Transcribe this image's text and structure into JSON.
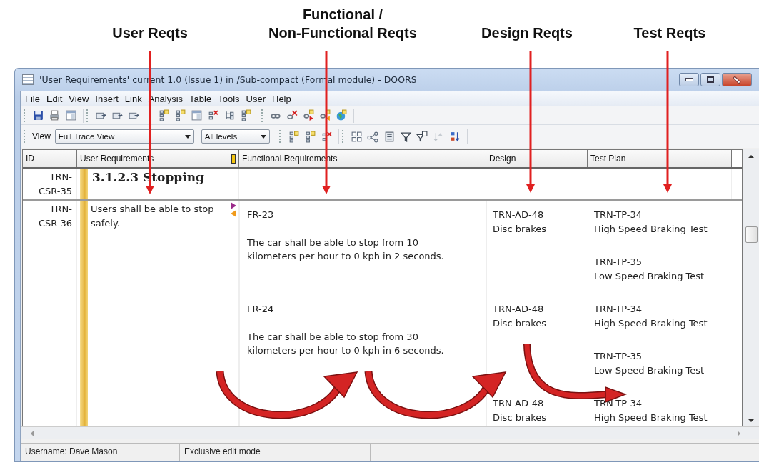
{
  "annotations": [
    {
      "lines": [
        "User Reqts"
      ]
    },
    {
      "lines": [
        "Functional /",
        "Non-Functional Reqts"
      ]
    },
    {
      "lines": [
        "Design Reqts"
      ]
    },
    {
      "lines": [
        "Test Reqts"
      ]
    }
  ],
  "window": {
    "title": "'User Requirements' current 1.0 (Issue 1) in /Sub-compact (Formal module) - DOORS"
  },
  "menu": [
    "File",
    "Edit",
    "View",
    "Insert",
    "Link",
    "Analysis",
    "Table",
    "Tools",
    "User",
    "Help"
  ],
  "view_bar": {
    "label": "View",
    "view": "Full Trace View",
    "levels": "All levels"
  },
  "table": {
    "columns": [
      "ID",
      "User Requirements",
      "Functional Requirements",
      "Design",
      "Test Plan"
    ],
    "rows": [
      {
        "kind": "heading",
        "id": "TRN-CSR-35",
        "text": "3.1.2.3 Stopping"
      },
      {
        "kind": "requirement",
        "id": "TRN-CSR-36",
        "text": "Users shall be able to stop safely.",
        "out_link": true,
        "in_link": true,
        "traces": [
          {
            "id": "FR-23",
            "text": "The car shall be able to stop from 10 kilometers per hour to 0 kph in 2 seconds.",
            "design": [
              {
                "id": "TRN-AD-48",
                "title": "Disc brakes",
                "tests": [
                  {
                    "id": "TRN-TP-34",
                    "title": "High Speed Braking Test"
                  },
                  {
                    "id": "TRN-TP-35",
                    "title": "Low Speed Braking Test"
                  }
                ]
              }
            ]
          },
          {
            "id": "FR-24",
            "text": "The car shall be able to stop from 30 kilometers per hour to 0 kph in 6 seconds.",
            "design": [
              {
                "id": "TRN-AD-48",
                "title": "Disc brakes",
                "tests": [
                  {
                    "id": "TRN-TP-34",
                    "title": "High Speed Braking Test"
                  },
                  {
                    "id": "TRN-TP-35",
                    "title": "Low Speed Braking Test"
                  }
                ]
              },
              {
                "id": "TRN-AD-48",
                "title": "Disc brakes",
                "tests": [
                  {
                    "id": "TRN-TP-34",
                    "title": "High Speed Braking Test"
                  }
                ]
              }
            ]
          }
        ]
      }
    ]
  },
  "status_bar": [
    "Username: Dave Mason",
    "Exclusive edit mode"
  ]
}
